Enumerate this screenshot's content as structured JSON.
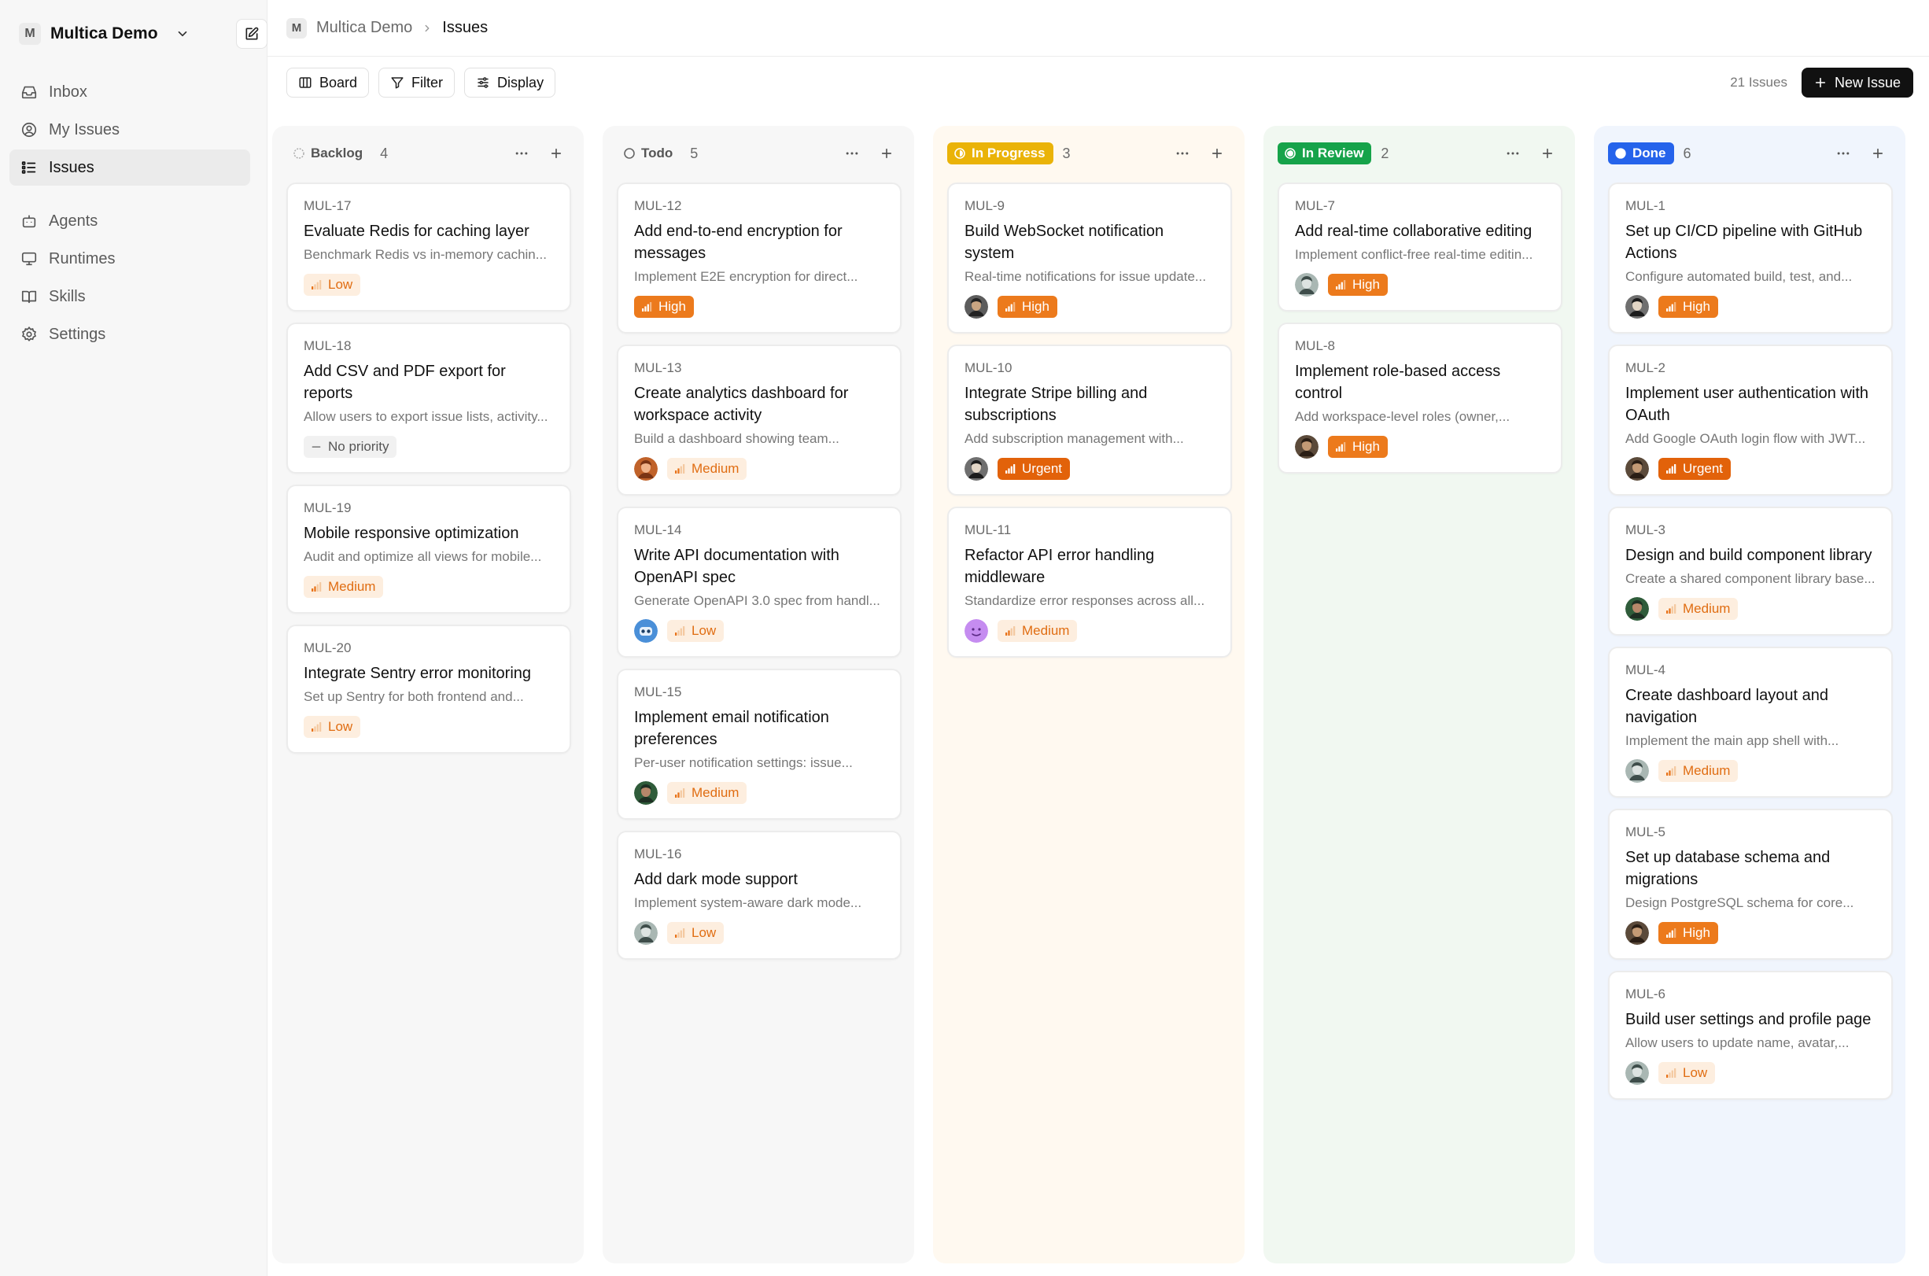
{
  "workspace": {
    "initial": "M",
    "name": "Multica Demo"
  },
  "nav": {
    "primary": [
      {
        "key": "inbox",
        "label": "Inbox",
        "icon": "inbox-icon",
        "active": false
      },
      {
        "key": "my-issues",
        "label": "My Issues",
        "icon": "user-circle-icon",
        "active": false
      },
      {
        "key": "issues",
        "label": "Issues",
        "icon": "list-icon",
        "active": true
      }
    ],
    "secondary": [
      {
        "key": "agents",
        "label": "Agents",
        "icon": "bot-icon",
        "active": false
      },
      {
        "key": "runtimes",
        "label": "Runtimes",
        "icon": "monitor-icon",
        "active": false
      },
      {
        "key": "skills",
        "label": "Skills",
        "icon": "book-icon",
        "active": false
      },
      {
        "key": "settings",
        "label": "Settings",
        "icon": "gear-icon",
        "active": false
      }
    ]
  },
  "breadcrumb": {
    "initial": "M",
    "workspace": "Multica Demo",
    "page": "Issues"
  },
  "toolbar": {
    "board_label": "Board",
    "filter_label": "Filter",
    "display_label": "Display",
    "issue_count": "21 Issues",
    "new_issue_label": "New Issue"
  },
  "colors": {
    "low": "#f0913a",
    "medium": "#f0913a",
    "high": "#ec7a1c",
    "urgent": "#e2620a",
    "inprogress": "#eab308",
    "inreview": "#16a34a",
    "done": "#2563eb"
  },
  "columns": [
    {
      "key": "backlog",
      "label": "Backlog",
      "count": "4",
      "cards": [
        {
          "id": "MUL-17",
          "title": "Evaluate Redis for caching layer",
          "desc": "Benchmark Redis vs in-memory cachin...",
          "priority": "low",
          "priority_label": "Low",
          "avatar": null
        },
        {
          "id": "MUL-18",
          "title": "Add CSV and PDF export for reports",
          "desc": "Allow users to export issue lists, activity...",
          "priority": "none",
          "priority_label": "No priority",
          "avatar": null
        },
        {
          "id": "MUL-19",
          "title": "Mobile responsive optimization",
          "desc": "Audit and optimize all views for mobile...",
          "priority": "medium",
          "priority_label": "Medium",
          "avatar": null
        },
        {
          "id": "MUL-20",
          "title": "Integrate Sentry error monitoring",
          "desc": "Set up Sentry for both frontend and...",
          "priority": "low",
          "priority_label": "Low",
          "avatar": null
        }
      ]
    },
    {
      "key": "todo",
      "label": "Todo",
      "count": "5",
      "cards": [
        {
          "id": "MUL-12",
          "title": "Add end-to-end encryption for messages",
          "desc": "Implement E2E encryption for direct...",
          "priority": "high",
          "priority_label": "High",
          "avatar": null
        },
        {
          "id": "MUL-13",
          "title": "Create analytics dashboard for workspace activity",
          "desc": "Build a dashboard showing team...",
          "priority": "medium",
          "priority_label": "Medium",
          "avatar": "a1"
        },
        {
          "id": "MUL-14",
          "title": "Write API documentation with OpenAPI spec",
          "desc": "Generate OpenAPI 3.0 spec from handl...",
          "priority": "low",
          "priority_label": "Low",
          "avatar": "robot"
        },
        {
          "id": "MUL-15",
          "title": "Implement email notification preferences",
          "desc": "Per-user notification settings: issue...",
          "priority": "medium",
          "priority_label": "Medium",
          "avatar": "a2"
        },
        {
          "id": "MUL-16",
          "title": "Add dark mode support",
          "desc": "Implement system-aware dark mode...",
          "priority": "low",
          "priority_label": "Low",
          "avatar": "a3"
        }
      ]
    },
    {
      "key": "inprogress",
      "label": "In Progress",
      "count": "3",
      "cards": [
        {
          "id": "MUL-9",
          "title": "Build WebSocket notification system",
          "desc": "Real-time notifications for issue update...",
          "priority": "high",
          "priority_label": "High",
          "avatar": "a4"
        },
        {
          "id": "MUL-10",
          "title": "Integrate Stripe billing and subscriptions",
          "desc": "Add subscription management with...",
          "priority": "urgent",
          "priority_label": "Urgent",
          "avatar": "a5"
        },
        {
          "id": "MUL-11",
          "title": "Refactor API error handling middleware",
          "desc": "Standardize error responses across all...",
          "priority": "medium",
          "priority_label": "Medium",
          "avatar": "purple"
        }
      ]
    },
    {
      "key": "inreview",
      "label": "In Review",
      "count": "2",
      "cards": [
        {
          "id": "MUL-7",
          "title": "Add real-time collaborative editing",
          "desc": "Implement conflict-free real-time editin...",
          "priority": "high",
          "priority_label": "High",
          "avatar": "a3"
        },
        {
          "id": "MUL-8",
          "title": "Implement role-based access control",
          "desc": "Add workspace-level roles (owner,...",
          "priority": "high",
          "priority_label": "High",
          "avatar": "a6"
        }
      ]
    },
    {
      "key": "done",
      "label": "Done",
      "count": "6",
      "cards": [
        {
          "id": "MUL-1",
          "title": "Set up CI/CD pipeline with GitHub Actions",
          "desc": "Configure automated build, test, and...",
          "priority": "high",
          "priority_label": "High",
          "avatar": "a5"
        },
        {
          "id": "MUL-2",
          "title": "Implement user authentication with OAuth",
          "desc": "Add Google OAuth login flow with JWT...",
          "priority": "urgent",
          "priority_label": "Urgent",
          "avatar": "a6"
        },
        {
          "id": "MUL-3",
          "title": "Design and build component library",
          "desc": "Create a shared component library base...",
          "priority": "medium",
          "priority_label": "Medium",
          "avatar": "a2"
        },
        {
          "id": "MUL-4",
          "title": "Create dashboard layout and navigation",
          "desc": "Implement the main app shell with...",
          "priority": "medium",
          "priority_label": "Medium",
          "avatar": "a3"
        },
        {
          "id": "MUL-5",
          "title": "Set up database schema and migrations",
          "desc": "Design PostgreSQL schema for core...",
          "priority": "high",
          "priority_label": "High",
          "avatar": "a6"
        },
        {
          "id": "MUL-6",
          "title": "Build user settings and profile page",
          "desc": "Allow users to update name, avatar,...",
          "priority": "low",
          "priority_label": "Low",
          "avatar": "a3"
        }
      ]
    }
  ]
}
